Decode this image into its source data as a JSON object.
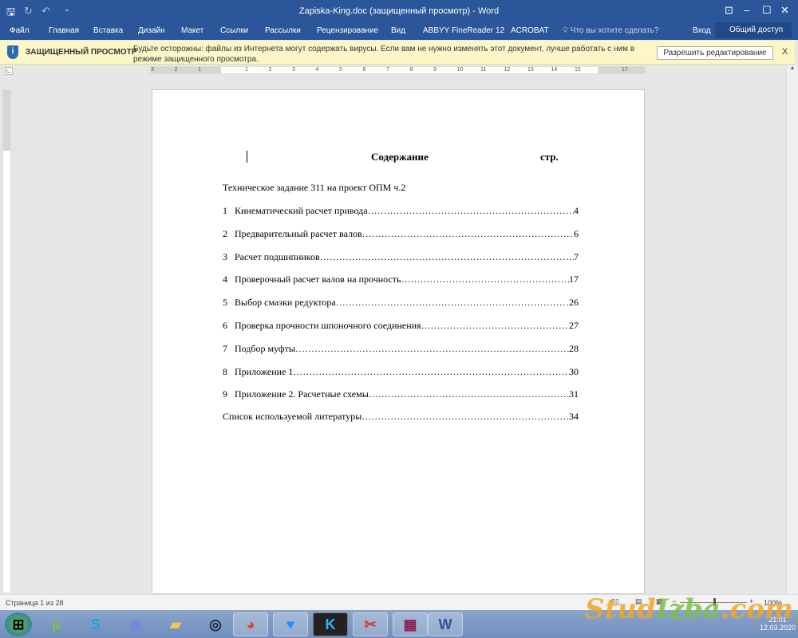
{
  "window": {
    "title": "Zapiska-King.doc (защищенный просмотр) - Word"
  },
  "ribbon": {
    "tabs": [
      "Файл",
      "Главная",
      "Вставка",
      "Дизайн",
      "Макет",
      "Ссылки",
      "Рассылки",
      "Рецензирование",
      "Вид",
      "ABBYY FineReader 12",
      "ACROBAT"
    ],
    "tell_me": "Что вы хотите сделать?",
    "signin": "Вход",
    "share": "Общий доступ"
  },
  "protected": {
    "label": "ЗАЩИЩЕННЫЙ ПРОСМОТР",
    "message": "Будьте осторожны: файлы из Интернета могут содержать вирусы. Если вам не нужно изменять этот документ, лучше работать с ним в режиме защищенного просмотра.",
    "enable_button": "Разрешить редактирование",
    "close": "X"
  },
  "ruler": {
    "marks": [
      "3",
      "2",
      "1",
      "",
      "1",
      "2",
      "3",
      "4",
      "5",
      "6",
      "7",
      "8",
      "9",
      "10",
      "11",
      "12",
      "13",
      "14",
      "15",
      "",
      "17"
    ]
  },
  "document": {
    "heading": "Содержание",
    "page_col": "стр.",
    "intro": "Техническое задание 311 на проект ОПМ ч.2",
    "toc": [
      {
        "num": "1",
        "title": "Кинематический расчет привода",
        "page": "4"
      },
      {
        "num": "2",
        "title": "Предварительный расчет валов",
        "page": "6"
      },
      {
        "num": "3",
        "title": "Расчет подшипников",
        "page": "7"
      },
      {
        "num": "4",
        "title": "Проверочный расчет валов на прочность",
        "page": "17"
      },
      {
        "num": "5",
        "title": "Выбор смазки редуктора",
        "page": "26"
      },
      {
        "num": "6",
        "title": "Проверка прочности шпоночного соединения",
        "page": "27"
      },
      {
        "num": "7",
        "title": "Подбор муфты",
        "page": "28"
      },
      {
        "num": "8",
        "title": "Приложение 1",
        "page": "30"
      },
      {
        "num": "9",
        "title": "Приложение 2. Расчетные схемы",
        "page": "31"
      }
    ],
    "bibliography": {
      "title": "Список используемой литературы",
      "page": "34"
    }
  },
  "status": {
    "page": "Страница 1 из 28",
    "zoom": "100%",
    "zoom_level": 100
  },
  "taskbar": {
    "apps": [
      "start",
      "utorrent",
      "skype",
      "discord",
      "explorer",
      "steam",
      "chrome",
      "heart-app",
      "kompas",
      "scissors",
      "winrar",
      "word"
    ],
    "time": "21:01",
    "date": "12.03.2020"
  },
  "watermark": {
    "text1": "Stud",
    "text2": "Izba",
    ".com": ".com"
  }
}
